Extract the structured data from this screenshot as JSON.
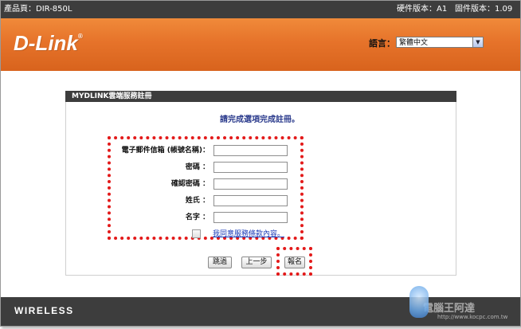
{
  "topbar": {
    "product": "產品頁：DIR-850L",
    "hardware": "硬件版本：A1",
    "firmware": "固件版本：1.09"
  },
  "brand": {
    "logo": "D-Link",
    "mark": "®"
  },
  "language": {
    "label": "語言：",
    "selected": "繁體中文"
  },
  "panel": {
    "title": "MYDLINK雲端服務註冊",
    "instruction": "請完成選項完成註冊。"
  },
  "form": {
    "fields": [
      {
        "label": "電子郵件信箱 (帳號名稱)：",
        "value": ""
      },
      {
        "label": "密碼 ：",
        "value": ""
      },
      {
        "label": "確認密碼 ：",
        "value": ""
      },
      {
        "label": "姓氏 ：",
        "value": ""
      },
      {
        "label": "名字 ：",
        "value": ""
      }
    ],
    "agree_text": "我同意服務條款內容。",
    "agree_checked": false
  },
  "buttons": {
    "skip": "跳過",
    "prev": "上一步",
    "signup": "報名"
  },
  "footer": {
    "wireless": "WIRELESS",
    "watermark": "電腦王阿達",
    "watermark_url": "http://www.kocpc.com.tw"
  },
  "colors": {
    "banner": "#e6732a",
    "dark_bar": "#3d3d3d",
    "highlight": "#e31a1a",
    "instruction": "#2a3a8c",
    "link": "#1a3bb8"
  }
}
